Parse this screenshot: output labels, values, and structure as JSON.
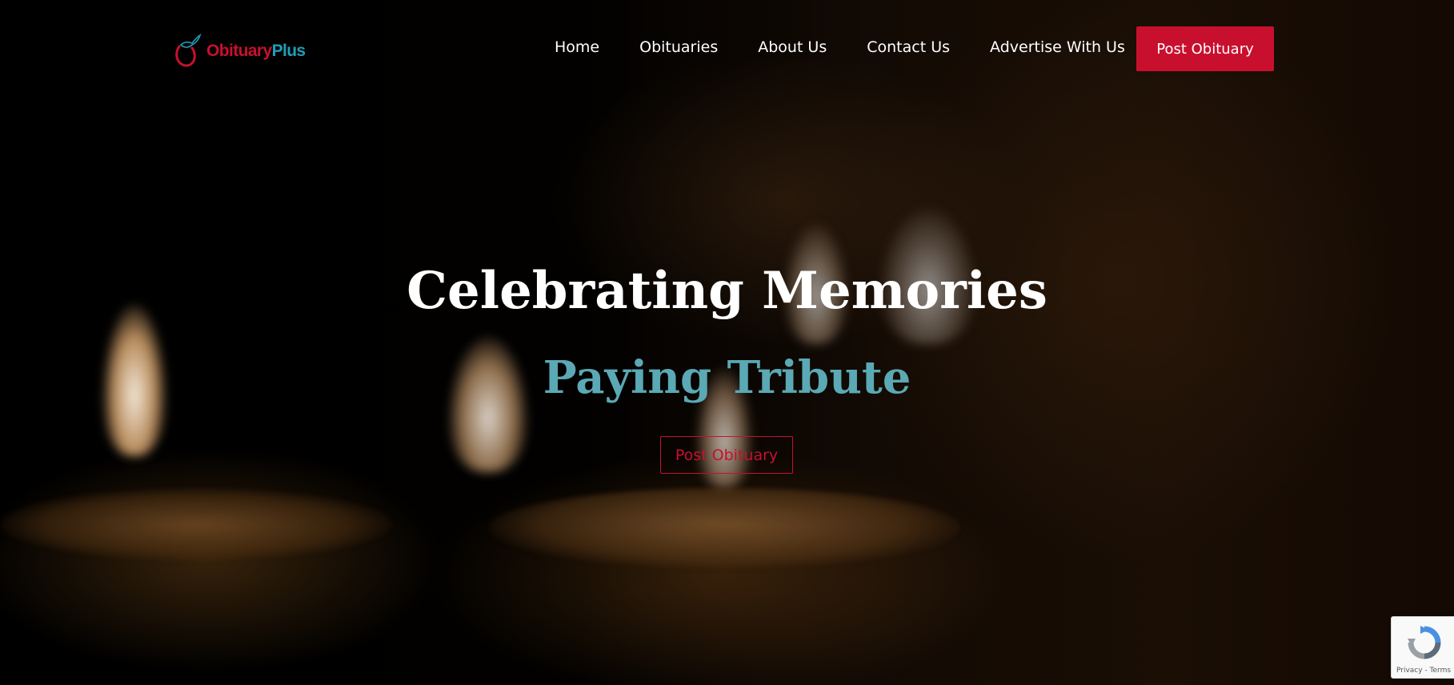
{
  "brand": {
    "name_part1": "Obituary",
    "name_part2": "Plus",
    "colors": {
      "red": "#c8102e",
      "teal": "#1f9fb8"
    }
  },
  "nav": {
    "links": [
      "Home",
      "Obituaries",
      "About Us",
      "Contact Us",
      "Advertise With Us"
    ],
    "cta_label": "Post Obituary"
  },
  "hero": {
    "title": "Celebrating Memories",
    "subtitle": "Paying Tribute",
    "cta_label": "Post Obituary",
    "colors": {
      "title": "#ffffff",
      "subtitle": "#5aa9b5",
      "button": "#c8102e"
    },
    "background": "candles"
  },
  "recaptcha": {
    "links": "Privacy - Terms",
    "icon": "recaptcha-icon"
  }
}
